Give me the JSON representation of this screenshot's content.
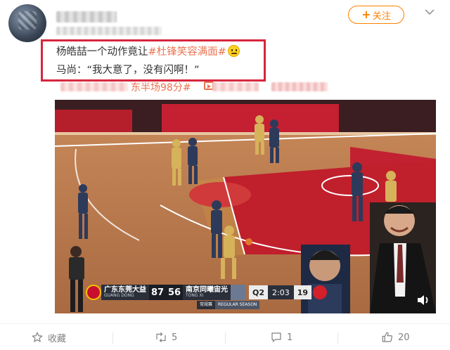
{
  "post": {
    "follow_label": "关注",
    "text_line1_prefix": "杨皓喆一个动作竟让",
    "text_line1_tag": "#杜锋笑容满面#",
    "text_line2": "马尚：“我大意了，没有闪啊！”",
    "topic_tag": "东半场98分#"
  },
  "video": {
    "scoreboard": {
      "home_name": "广东东莞大益",
      "home_en": "GUANG DONG",
      "home_score": "87",
      "away_score": "56",
      "away_name": "南京同曦宙光",
      "away_en": "TONG XI",
      "quarter": "Q2",
      "clock": "2:03",
      "shot_clock": "19",
      "sub_left": "常规赛",
      "sub_right": "REGULAR SEASON"
    }
  },
  "actions": {
    "favorite_label": "收藏",
    "repost_count": "5",
    "comment_count": "1",
    "like_count": "20"
  },
  "colors": {
    "accent": "#ff8200",
    "tag": "#eb7350",
    "highlight_box": "#d7263d"
  }
}
